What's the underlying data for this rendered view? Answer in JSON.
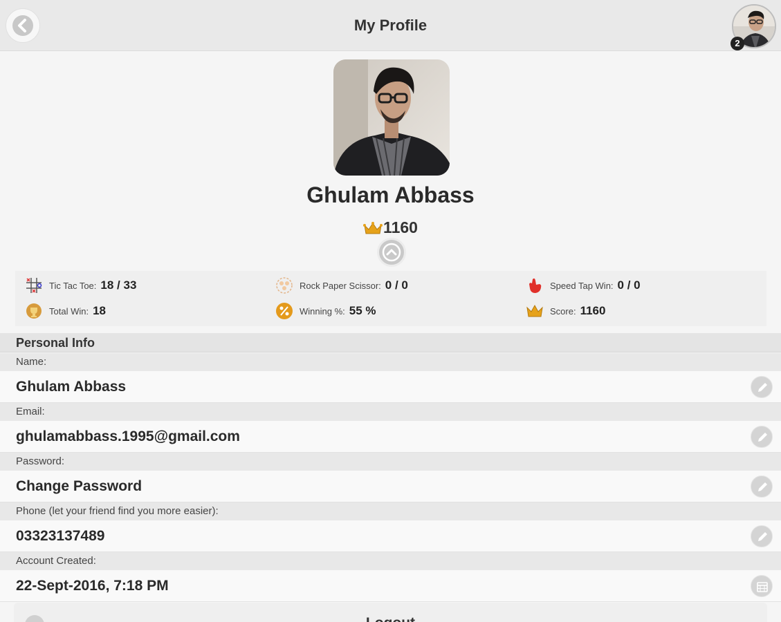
{
  "header": {
    "title": "My Profile",
    "back_icon": "chevron-left-icon",
    "avatar_badge": "2"
  },
  "profile": {
    "name": "Ghulam Abbass",
    "score": "1160",
    "score_icon": "crown-icon"
  },
  "stats": [
    {
      "icon": "tic-tac-toe-icon",
      "label": "Tic Tac Toe:",
      "value": "18 / 33"
    },
    {
      "icon": "rock-paper-scissor-icon",
      "label": "Rock Paper Scissor:",
      "value": "0 / 0"
    },
    {
      "icon": "speed-tap-icon",
      "label": "Speed Tap Win:",
      "value": "0 / 0"
    },
    {
      "icon": "trophy-icon",
      "label": "Total Win:",
      "value": "18"
    },
    {
      "icon": "percent-icon",
      "label": "Winning %:",
      "value": "55 %"
    },
    {
      "icon": "crown-icon",
      "label": "Score:",
      "value": "1160"
    }
  ],
  "personal_info": {
    "section_title": "Personal Info",
    "fields": [
      {
        "label": "Name:",
        "value": "Ghulam Abbass",
        "action_icon": "pencil-icon"
      },
      {
        "label": "Email:",
        "value": "ghulamabbass.1995@gmail.com",
        "action_icon": "pencil-icon"
      },
      {
        "label": "Password:",
        "value": "Change Password",
        "action_icon": "pencil-icon"
      },
      {
        "label": "Phone (let your friend find you more easier):",
        "value": "03323137489",
        "action_icon": "pencil-icon"
      },
      {
        "label": "Account Created:",
        "value": "22-Sept-2016, 7:18 PM",
        "action_icon": "calendar-icon"
      }
    ]
  },
  "logout": {
    "label": "Logout",
    "icon": "power-icon"
  },
  "colors": {
    "header_bg": "#e9e9e9",
    "page_bg": "#f5f5f5",
    "crown_gold": "#e6a21a",
    "speed_tap_red": "#e0302a",
    "percent_orange": "#e49a1c"
  }
}
